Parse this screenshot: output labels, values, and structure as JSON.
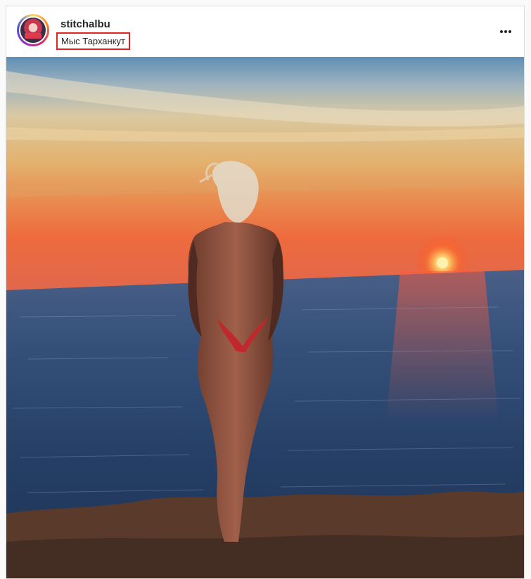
{
  "post": {
    "username": "stitchalbu",
    "location": "Мыс Тарханкут"
  },
  "icons": {
    "avatar": "profile-avatar",
    "more": "more-options-icon"
  },
  "colors": {
    "highlight_border": "#e02424",
    "text": "#262626",
    "sky_top": "#5f8fb5",
    "sun": "#fff2b0",
    "sea": "#1e3352"
  }
}
